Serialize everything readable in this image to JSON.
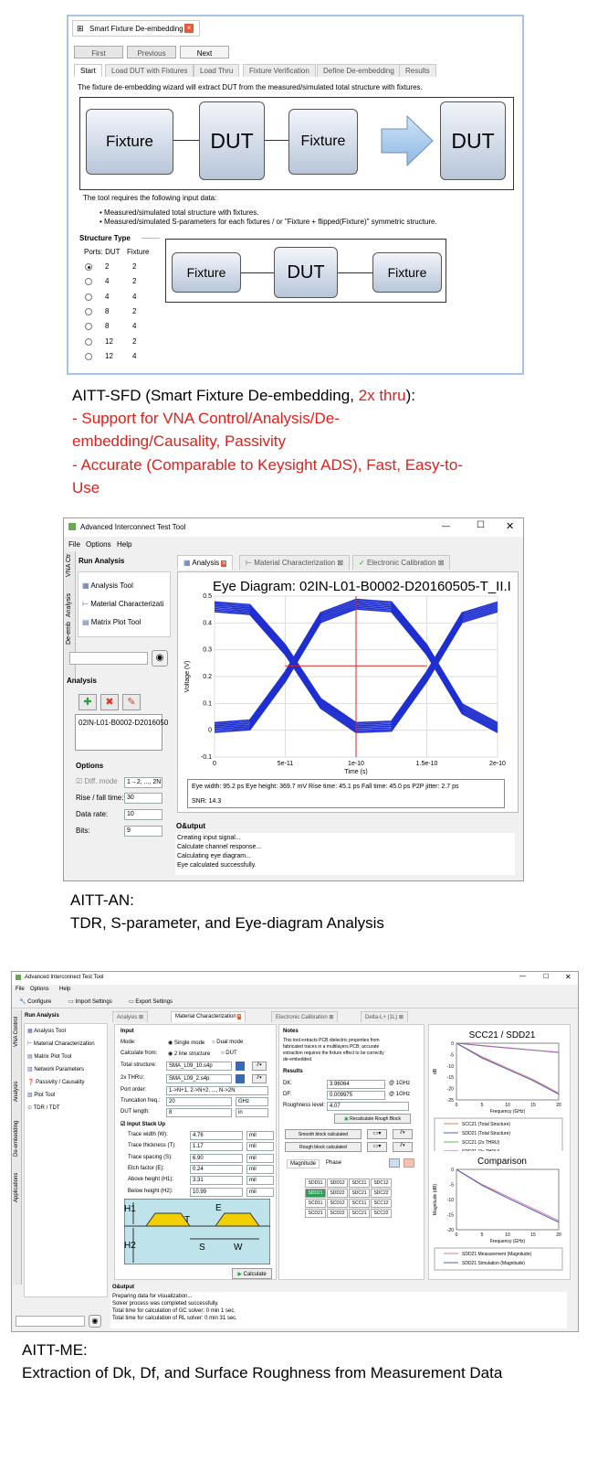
{
  "sfd": {
    "title": "Smart Fixture De-embedding",
    "buttons": {
      "first": "First",
      "previous": "Previous",
      "next": "Next"
    },
    "tabs": [
      "Start",
      "Load DUT with Fixtures",
      "Load Thru",
      "Fixture Verification",
      "Define De-embedding",
      "Results"
    ],
    "intro": "The fixture de-embedding wizard will extract DUT from the measured/simulated total structure with fixtures.",
    "diagram": {
      "fixture": "Fixture",
      "dut": "DUT"
    },
    "req_title": "The tool requires the following input data:",
    "req_items": [
      "Measured/simulated total structure with fixtures.",
      "Measured/simulated S-parameters for each fixtures / or \"Fixture + flipped(Fixture)\" symmetric structure."
    ],
    "structure_type": "Structure Type",
    "ports_label": "Ports: DUT",
    "fixture_col": "Fixture",
    "rows": [
      {
        "dut": "2",
        "fixture": "2",
        "selected": true
      },
      {
        "dut": "4",
        "fixture": "2",
        "selected": false
      },
      {
        "dut": "4",
        "fixture": "4",
        "selected": false
      },
      {
        "dut": "8",
        "fixture": "2",
        "selected": false
      },
      {
        "dut": "8",
        "fixture": "4",
        "selected": false
      },
      {
        "dut": "12",
        "fixture": "2",
        "selected": false
      },
      {
        "dut": "12",
        "fixture": "4",
        "selected": false
      }
    ]
  },
  "caption1": {
    "line1_a": "AITT-SFD (Smart Fixture De-embedding, ",
    "line1_b": "2x thru",
    "line1_c": "):",
    "line2": "- Support for VNA Control/Analysis/De-",
    "line3": "embedding/Causality, Passivity",
    "line4": "- Accurate (Comparable to Keysight ADS), Fast, Easy-to-",
    "line5": "Use"
  },
  "an": {
    "title": "Advanced Interconnect Test Tool",
    "menu": [
      "File",
      "Options",
      "Help"
    ],
    "side_tabs": [
      "VNA Ctr",
      "Analysis",
      "De-emb"
    ],
    "run_analysis": "Run Analysis",
    "tools": [
      "Analysis Tool",
      "Material Characterizati",
      "Matrix Plot Tool"
    ],
    "analysis_header": "Analysis",
    "file_item": "02IN-L01-B0002-D2016050",
    "options_header": "Options",
    "diff_mode": "Diff. mode",
    "diff_value": "1→2, ..., 2N",
    "rise_fall_label": "Rise / fall time:",
    "rise_fall_value": "30",
    "data_rate_label": "Data rate:",
    "data_rate_value": "10",
    "bits_label": "Bits:",
    "bits_value": "9",
    "main_tabs": [
      "Analysis",
      "Material Characterization",
      "Electronic Calibration"
    ],
    "output_header": "O&utput",
    "output_lines": [
      "Creating input signal...",
      "Calculate channel response...",
      "Calculating eye diagram...",
      "Eye calculated successfully."
    ],
    "metrics1": "Eye width: 95.2 ps    Eye height: 369.7 mV    Rise time: 45.1 ps    Fall time: 45.0 ps    P2P jitter: 2.7 ps",
    "metrics2": "SNR: 14.3"
  },
  "chart_data": [
    {
      "type": "line",
      "title": "Eye Diagram: 02IN-L01-B0002-D20160505-T_II.I",
      "xlabel": "Time (s)",
      "ylabel": "Voltage (V)",
      "xlim": [
        0,
        2e-10
      ],
      "ylim": [
        -0.1,
        0.5
      ],
      "x_ticks": [
        "0",
        "5e-11",
        "1e-10",
        "1.5e-10",
        "2e-10"
      ],
      "y_ticks": [
        "0.5",
        "0.4",
        "0.3",
        "0.2",
        "0.1",
        "0",
        "-0.1"
      ],
      "series": [
        {
          "values_x": [
            0,
            2.5e-11,
            5e-11,
            7.5e-11,
            1e-10,
            1.25e-10,
            1.5e-10,
            1.75e-10,
            2e-10
          ],
          "values_y": [
            0.46,
            0.45,
            0.3,
            0.1,
            0.01,
            0.015,
            0.2,
            0.42,
            0.46
          ]
        },
        {
          "values_x": [
            0,
            2.5e-11,
            5e-11,
            7.5e-11,
            1e-10,
            1.25e-10,
            1.5e-10,
            1.75e-10,
            2e-10
          ],
          "values_y": [
            0.01,
            0.02,
            0.2,
            0.42,
            0.47,
            0.46,
            0.3,
            0.08,
            0.01
          ]
        }
      ],
      "grid": true
    },
    {
      "type": "line",
      "title": "SCC21 / SDD21",
      "xlabel": "Frequency (GHz)",
      "ylabel": "dB",
      "xlim": [
        0,
        20
      ],
      "ylim": [
        -25,
        0
      ],
      "x_ticks": [
        "0",
        "5",
        "10",
        "15",
        "20"
      ],
      "y_ticks": [
        "0",
        "-5",
        "-10",
        "-15",
        "-20",
        "-25"
      ],
      "series": [
        {
          "name": "SCC21 (Total Structure)",
          "color": "#e07a6a",
          "x": [
            0,
            5,
            10,
            15,
            20
          ],
          "y": [
            0,
            -6,
            -11,
            -16,
            -22
          ]
        },
        {
          "name": "SDD21 (Total Structure)",
          "color": "#4a5fc4",
          "x": [
            0,
            5,
            10,
            15,
            20
          ],
          "y": [
            0,
            -6.5,
            -11.5,
            -16.5,
            -22.5
          ]
        },
        {
          "name": "SCC21 (2x THRU)",
          "color": "#6ab06a",
          "x": [
            0,
            5,
            10,
            15,
            20
          ],
          "y": [
            0,
            -1,
            -2,
            -3,
            -4
          ]
        },
        {
          "name": "SDD21 (2x THRU)",
          "color": "#b05ac0",
          "x": [
            0,
            5,
            10,
            15,
            20
          ],
          "y": [
            0,
            -1.1,
            -2.1,
            -3.1,
            -4.1
          ]
        }
      ]
    },
    {
      "type": "line",
      "title": "Comparison",
      "xlabel": "Frequency (GHz)",
      "ylabel": "Magnitude (dB)",
      "xlim": [
        0,
        20
      ],
      "ylim": [
        -20,
        0
      ],
      "x_ticks": [
        "0",
        "5",
        "10",
        "15",
        "20"
      ],
      "y_ticks": [
        "0",
        "-5",
        "-10",
        "-15",
        "-20"
      ],
      "series": [
        {
          "name": "SDD21 Measurement (Magnitude)",
          "color": "#e07a9a",
          "x": [
            0,
            5,
            10,
            15,
            20
          ],
          "y": [
            0,
            -5,
            -9,
            -13,
            -17
          ]
        },
        {
          "name": "SDD21 Simulation (Magnitude)",
          "color": "#4a5fc4",
          "x": [
            0,
            5,
            10,
            15,
            20
          ],
          "y": [
            0,
            -5.3,
            -9.5,
            -13.5,
            -17.5
          ]
        }
      ]
    }
  ],
  "caption2": {
    "line1": "AITT-AN:",
    "line2": "TDR, S-parameter, and Eye-diagram Analysis"
  },
  "me": {
    "title": "Advanced Interconnect Test Tool",
    "menu": [
      "File",
      "Options",
      "Help"
    ],
    "toolbar": [
      "Configure",
      "Import Settings",
      "Export Settings"
    ],
    "side_tabs": [
      "VNA Control",
      "Analysis",
      "De-embedding",
      "Applications"
    ],
    "run_analysis": "Run Analysis",
    "tools": [
      "Analysis Tool",
      "Material Characterization",
      "Matrix Plot Tool",
      "Network Parameters",
      "Passivity / Causality",
      "Plot Tool",
      "TDR / TDT"
    ],
    "main_tabs": [
      "Analysis",
      "Material Characterization",
      "Electronic Calibration",
      "Delta-L+ (1L)"
    ],
    "input": {
      "header": "Input",
      "mode_label": "Mode:",
      "mode_single": "Single mode",
      "mode_dual": "Dual mode",
      "calc_label": "Calculate from:",
      "calc_a": "2 line structure",
      "calc_b": "DUT",
      "total_label": "Total structure:",
      "total_value": "SMA_L09_10.s4p",
      "thru_label": "2x THRU:",
      "thru_value": "SMA_L09_2.s4p",
      "port_label": "Port order:",
      "port_value": "1->N+1, 2->N+2, ..., N->2N",
      "trunc_label": "Truncation freq.:",
      "trunc_value": "20",
      "trunc_unit": "GHz",
      "dut_label": "DUT length:",
      "dut_value": "8",
      "dut_unit": "in",
      "stackup": "Input Stack Up",
      "params": [
        {
          "label": "Trace width (W):",
          "value": "4.76",
          "unit": "mil"
        },
        {
          "label": "Trace thickness (T):",
          "value": "1.17",
          "unit": "mil"
        },
        {
          "label": "Trace spacing (S):",
          "value": "6.90",
          "unit": "mil"
        },
        {
          "label": "Etch factor (E):",
          "value": "0.24",
          "unit": "mil"
        },
        {
          "label": "Above height (H1):",
          "value": "3.31",
          "unit": "mil"
        },
        {
          "label": "Below height (H2):",
          "value": "10.99",
          "unit": "mil"
        }
      ],
      "diagram_labels": {
        "h1": "H1",
        "h2": "H2",
        "t": "T",
        "e": "E",
        "s": "S",
        "w": "W"
      },
      "calculate": "Calculate"
    },
    "notes": {
      "header": "Notes",
      "text": [
        "This tool extracts PCB dielectric properties from",
        "fabricated traces in a multilayers PCB; accurate",
        "extraction requires the fixture effect to be correctly",
        "de-embedded."
      ]
    },
    "results": {
      "header": "Results",
      "dk_label": "DK:",
      "dk_value": "3.96064",
      "dk_at": "@ 1GHz",
      "df_label": "DF:",
      "df_value": "0.009975",
      "df_at": "@ 1GHz",
      "rough_label": "Roughness level:",
      "rough_value": "4.07",
      "recalc": "Recalculate Rough Block",
      "smooth": "Smooth block calculated",
      "rough_block": "Rough block calculated",
      "tabs": [
        "Magnitude",
        "Phase"
      ],
      "matrix": [
        [
          "SDD11",
          "SDD12",
          "SDC11",
          "SDC12"
        ],
        [
          "SDD21",
          "SDD22",
          "SDC21",
          "SDC22"
        ],
        [
          "SCD11",
          "SCD12",
          "SCC11",
          "SCC12"
        ],
        [
          "SCD21",
          "SCD22",
          "SCC21",
          "SCC22"
        ]
      ]
    },
    "output_header": "O&utput",
    "output_lines": [
      "Preparing data for visualization...",
      "Solver process was completed successfully.",
      "Total time for calculation of GC solver: 0 min 1 sec.",
      "Total time for calculation of RL solver: 0 min 31 sec."
    ]
  },
  "caption3": {
    "line1": "AITT-ME:",
    "line2": "Extraction of Dk, Df, and Surface Roughness from Measurement Data"
  }
}
